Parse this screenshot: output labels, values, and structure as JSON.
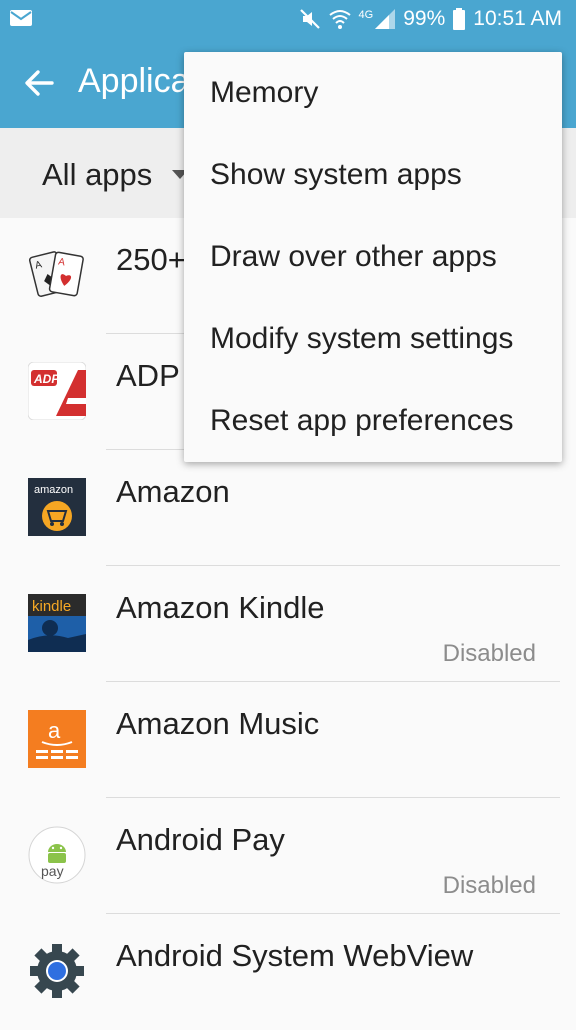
{
  "status_bar": {
    "battery": "99%",
    "time": "10:51 AM",
    "network": "4G",
    "icons": [
      "mail-icon",
      "mute-icon",
      "wifi-icon",
      "signal-icon",
      "battery-icon"
    ]
  },
  "app_bar": {
    "title": "Applica",
    "back_icon": "arrow-left-icon",
    "color": "#4aa6d0"
  },
  "filter": {
    "label": "All apps"
  },
  "apps": [
    {
      "name": "250+",
      "status": "",
      "icon": "solitaire-cards-icon"
    },
    {
      "name": "ADP",
      "status": "",
      "icon": "adp-icon"
    },
    {
      "name": "Amazon",
      "status": "",
      "icon": "amazon-icon"
    },
    {
      "name": "Amazon Kindle",
      "status": "Disabled",
      "icon": "kindle-icon"
    },
    {
      "name": "Amazon Music",
      "status": "",
      "icon": "amazon-music-icon"
    },
    {
      "name": "Android Pay",
      "status": "Disabled",
      "icon": "android-pay-icon"
    },
    {
      "name": "Android System WebView",
      "status": "",
      "icon": "webview-gear-icon"
    }
  ],
  "icon_text": {
    "amazon": "amazon",
    "kindle": "kindle",
    "pay": "pay",
    "music": "a",
    "adp": "ADP"
  },
  "overflow_menu": {
    "items": [
      "Memory",
      "Show system apps",
      "Draw over other apps",
      "Modify system settings",
      "Reset app preferences"
    ]
  }
}
